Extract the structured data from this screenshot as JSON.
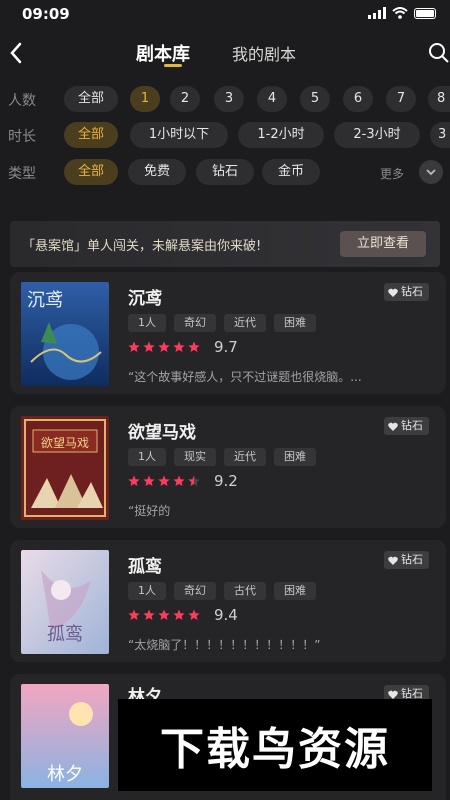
{
  "status_bar": {
    "time": "09:09"
  },
  "nav": {
    "tabs": [
      "剧本库",
      "我的剧本"
    ],
    "active_tab": 0
  },
  "filters": {
    "people": {
      "label": "人数",
      "options": [
        "全部",
        "1",
        "2",
        "3",
        "4",
        "5",
        "6",
        "7",
        "8"
      ],
      "selected": "1"
    },
    "duration": {
      "label": "时长",
      "options": [
        "全部",
        "1小时以下",
        "1-2小时",
        "2-3小时",
        "3"
      ],
      "selected": "全部"
    },
    "type": {
      "label": "类型",
      "options": [
        "全部",
        "免费",
        "钻石",
        "金币"
      ],
      "selected": "全部",
      "more_label": "更多"
    }
  },
  "banner": {
    "text": "「悬案馆」单人闯关，未解悬案由你来破!",
    "button_label": "立即查看"
  },
  "scripts": [
    {
      "title": "沉鸢",
      "badge": "钻石",
      "tags": [
        "1人",
        "奇幻",
        "近代",
        "困难"
      ],
      "stars": 5,
      "score": "9.7",
      "review": "“这个故事好感人，只不过谜题也很烧脑。...",
      "cover_text": "沉鸢"
    },
    {
      "title": "欲望马戏",
      "badge": "钻石",
      "tags": [
        "1人",
        "现实",
        "近代",
        "困难"
      ],
      "stars": 4.5,
      "score": "9.2",
      "review": "“挺好的",
      "cover_text": "欲望马戏"
    },
    {
      "title": "孤鸾",
      "badge": "钻石",
      "tags": [
        "1人",
        "奇幻",
        "古代",
        "困难"
      ],
      "stars": 5,
      "score": "9.4",
      "review": "“太烧脑了！！！！！！！！！！！”",
      "cover_text": "孤鸾"
    },
    {
      "title": "林夕",
      "badge": "钻石",
      "cover_text": "林夕"
    }
  ],
  "watermark": {
    "text": "下载鸟资源"
  },
  "colors": {
    "accent": "#e8b340",
    "star": "#ff3b5c",
    "background": "#1c1c1e",
    "card": "#252527"
  }
}
